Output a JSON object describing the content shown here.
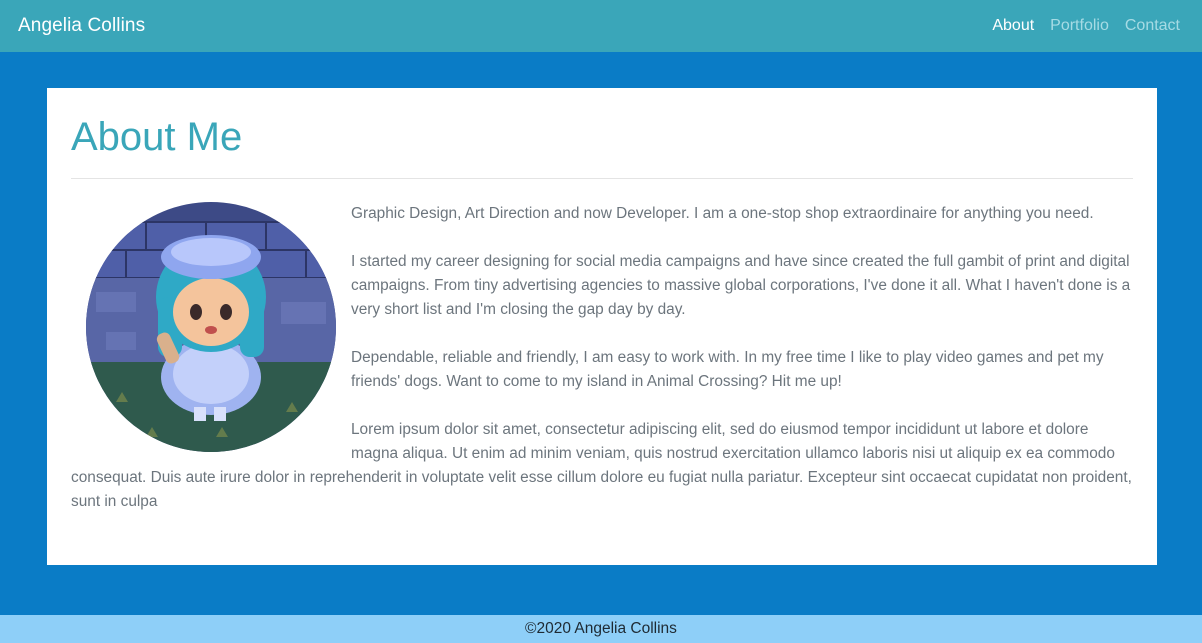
{
  "navbar": {
    "brand": "Angelia Collins",
    "links": [
      {
        "label": "About",
        "active": true
      },
      {
        "label": "Portfolio",
        "active": false
      },
      {
        "label": "Contact",
        "active": false
      }
    ]
  },
  "about": {
    "title": "About Me",
    "paragraphs": [
      "Graphic Design, Art Direction and now Developer. I am a one-stop shop extraordinaire for anything you need.",
      "I started my career designing for social media campaigns and have since created the full gambit of print and digital campaigns. From tiny advertising agencies to massive global corporations, I've done it all. What I haven't done is a very short list and I'm closing the gap day by day.",
      "Dependable, reliable and friendly, I am easy to work with. In my free time I like to play video games and pet my friends' dogs. Want to come to my island in Animal Crossing? Hit me up!",
      "Lorem ipsum dolor sit amet, consectetur adipiscing elit, sed do eiusmod tempor incididunt ut labore et dolore magna aliqua. Ut enim ad minim veniam, quis nostrud exercitation ullamco laboris nisi ut aliquip ex ea commodo consequat. Duis aute irure dolor in reprehenderit in voluptate velit esse cillum dolore eu fugiat nulla pariatur. Excepteur sint occaecat cupidatat non proident, sunt in culpa"
    ]
  },
  "footer": {
    "text": "©2020 Angelia Collins"
  },
  "colors": {
    "navbar": "#3aa6b9",
    "page_background": "#0a7cc6",
    "footer": "#8ecff8",
    "title": "#3aa6b9",
    "body_text": "#6c757d"
  }
}
